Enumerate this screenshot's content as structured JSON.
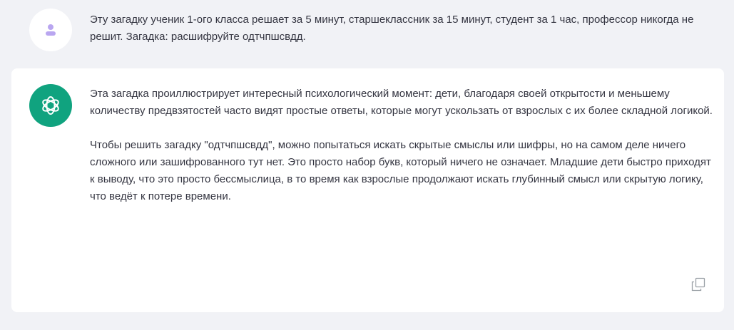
{
  "user_message": {
    "avatar_icon": "user-icon",
    "text": "Эту загадку ученик 1-ого класса решает за 5 минут, старшеклассник за 15 минут, студент за 1 час, профессор никогда не решит. Загадка: расшифруйте одтчпшсвдд."
  },
  "assistant_message": {
    "avatar_icon": "openai-logo-icon",
    "paragraphs": [
      "Эта загадка проиллюстрирует интересный психологический момент: дети, благодаря своей открытости и меньшему количеству предвзятостей часто видят простые ответы, которые могут ускользать от взрослых с их более складной логикой.",
      "Чтобы решить загадку \"одтчпшсвдд\", можно попытаться искать скрытые смыслы или шифры, но на самом деле ничего сложного или зашифрованного тут нет. Это просто набор букв, который ничего не означает. Младшие дети быстро приходят к выводу, что это просто бессмыслица, в то время как взрослые продолжают искать глубинный смысл или скрытую логику, что ведёт к потере времени."
    ],
    "copy_icon": "copy-icon"
  },
  "colors": {
    "background": "#f1f2f6",
    "card": "#ffffff",
    "text": "#343541",
    "bot_avatar": "#10a37f",
    "user_icon": "#b9a6f0"
  }
}
